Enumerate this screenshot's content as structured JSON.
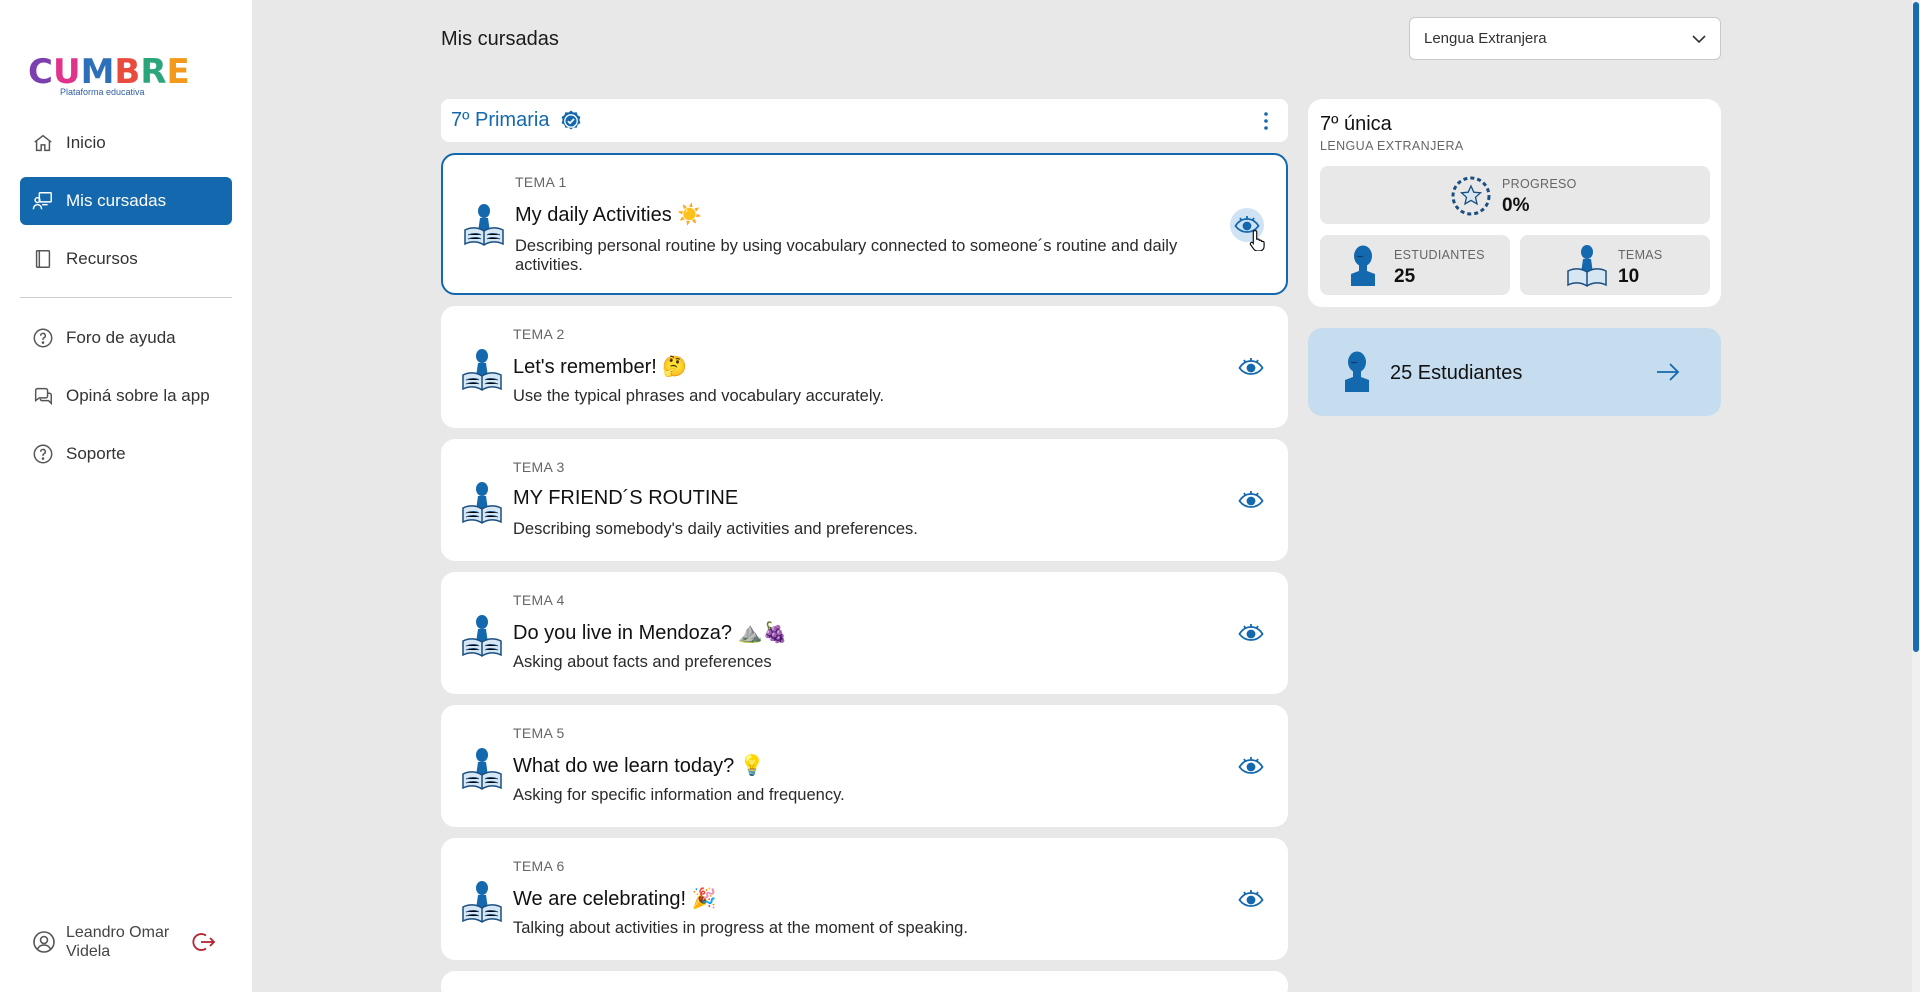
{
  "sidebar": {
    "logo_text": [
      "C",
      "U",
      "M",
      "B",
      "R",
      "E"
    ],
    "logo_sub": "Plataforma educativa",
    "nav": [
      {
        "label": "Inicio",
        "icon": "home-icon"
      },
      {
        "label": "Mis cursadas",
        "icon": "teacher-board-icon",
        "active": true
      },
      {
        "label": "Recursos",
        "icon": "book-icon"
      }
    ],
    "secondary": [
      {
        "label": "Foro de ayuda",
        "icon": "help-circle-icon"
      },
      {
        "label": "Opiná sobre la app",
        "icon": "chat-icon"
      },
      {
        "label": "Soporte",
        "icon": "help-circle-icon"
      }
    ],
    "user_name": "Leandro Omar Videla"
  },
  "header": {
    "title": "Mis cursadas",
    "subject_select": "Lengua Extranjera"
  },
  "course": {
    "name": "7º Primaria"
  },
  "topics": [
    {
      "num": "TEMA 1",
      "title": "My daily Activities ☀️",
      "desc": "Describing personal routine by using vocabulary connected to someone´s routine and daily activities."
    },
    {
      "num": "TEMA 2",
      "title": "Let's remember! 🤔",
      "desc": "Use the typical phrases and vocabulary accurately."
    },
    {
      "num": "TEMA 3",
      "title": "MY FRIEND´S ROUTINE",
      "desc": "Describing somebody's daily activities and preferences."
    },
    {
      "num": "TEMA 4",
      "title": "Do you live in Mendoza? ⛰️🍇",
      "desc": "Asking about facts and preferences"
    },
    {
      "num": "TEMA 5",
      "title": "What do we learn today? 💡",
      "desc": "Asking for specific information and frequency."
    },
    {
      "num": "TEMA 6",
      "title": "We are celebrating! 🎉",
      "desc": "Talking about activities in progress at the moment of speaking."
    }
  ],
  "summary": {
    "title": "7º única",
    "subtitle": "LENGUA EXTRANJERA",
    "progress_label": "PROGRESO",
    "progress_value": "0%",
    "students_label": "ESTUDIANTES",
    "students_value": "25",
    "topics_label": "TEMAS",
    "topics_value": "10"
  },
  "students_card": {
    "label": "25 Estudiantes"
  },
  "colors": {
    "primary": "#1468ad",
    "background": "#e8e8e8",
    "students_card": "#c5ddee"
  }
}
